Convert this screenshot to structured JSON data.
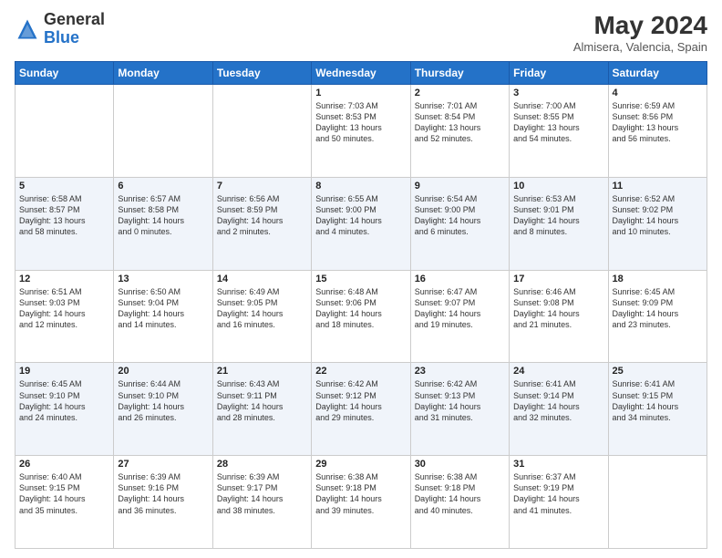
{
  "header": {
    "logo_general": "General",
    "logo_blue": "Blue",
    "month_title": "May 2024",
    "location": "Almisera, Valencia, Spain"
  },
  "weekdays": [
    "Sunday",
    "Monday",
    "Tuesday",
    "Wednesday",
    "Thursday",
    "Friday",
    "Saturday"
  ],
  "weeks": [
    [
      {
        "day": "",
        "info": ""
      },
      {
        "day": "",
        "info": ""
      },
      {
        "day": "",
        "info": ""
      },
      {
        "day": "1",
        "info": "Sunrise: 7:03 AM\nSunset: 8:53 PM\nDaylight: 13 hours\nand 50 minutes."
      },
      {
        "day": "2",
        "info": "Sunrise: 7:01 AM\nSunset: 8:54 PM\nDaylight: 13 hours\nand 52 minutes."
      },
      {
        "day": "3",
        "info": "Sunrise: 7:00 AM\nSunset: 8:55 PM\nDaylight: 13 hours\nand 54 minutes."
      },
      {
        "day": "4",
        "info": "Sunrise: 6:59 AM\nSunset: 8:56 PM\nDaylight: 13 hours\nand 56 minutes."
      }
    ],
    [
      {
        "day": "5",
        "info": "Sunrise: 6:58 AM\nSunset: 8:57 PM\nDaylight: 13 hours\nand 58 minutes."
      },
      {
        "day": "6",
        "info": "Sunrise: 6:57 AM\nSunset: 8:58 PM\nDaylight: 14 hours\nand 0 minutes."
      },
      {
        "day": "7",
        "info": "Sunrise: 6:56 AM\nSunset: 8:59 PM\nDaylight: 14 hours\nand 2 minutes."
      },
      {
        "day": "8",
        "info": "Sunrise: 6:55 AM\nSunset: 9:00 PM\nDaylight: 14 hours\nand 4 minutes."
      },
      {
        "day": "9",
        "info": "Sunrise: 6:54 AM\nSunset: 9:00 PM\nDaylight: 14 hours\nand 6 minutes."
      },
      {
        "day": "10",
        "info": "Sunrise: 6:53 AM\nSunset: 9:01 PM\nDaylight: 14 hours\nand 8 minutes."
      },
      {
        "day": "11",
        "info": "Sunrise: 6:52 AM\nSunset: 9:02 PM\nDaylight: 14 hours\nand 10 minutes."
      }
    ],
    [
      {
        "day": "12",
        "info": "Sunrise: 6:51 AM\nSunset: 9:03 PM\nDaylight: 14 hours\nand 12 minutes."
      },
      {
        "day": "13",
        "info": "Sunrise: 6:50 AM\nSunset: 9:04 PM\nDaylight: 14 hours\nand 14 minutes."
      },
      {
        "day": "14",
        "info": "Sunrise: 6:49 AM\nSunset: 9:05 PM\nDaylight: 14 hours\nand 16 minutes."
      },
      {
        "day": "15",
        "info": "Sunrise: 6:48 AM\nSunset: 9:06 PM\nDaylight: 14 hours\nand 18 minutes."
      },
      {
        "day": "16",
        "info": "Sunrise: 6:47 AM\nSunset: 9:07 PM\nDaylight: 14 hours\nand 19 minutes."
      },
      {
        "day": "17",
        "info": "Sunrise: 6:46 AM\nSunset: 9:08 PM\nDaylight: 14 hours\nand 21 minutes."
      },
      {
        "day": "18",
        "info": "Sunrise: 6:45 AM\nSunset: 9:09 PM\nDaylight: 14 hours\nand 23 minutes."
      }
    ],
    [
      {
        "day": "19",
        "info": "Sunrise: 6:45 AM\nSunset: 9:10 PM\nDaylight: 14 hours\nand 24 minutes."
      },
      {
        "day": "20",
        "info": "Sunrise: 6:44 AM\nSunset: 9:10 PM\nDaylight: 14 hours\nand 26 minutes."
      },
      {
        "day": "21",
        "info": "Sunrise: 6:43 AM\nSunset: 9:11 PM\nDaylight: 14 hours\nand 28 minutes."
      },
      {
        "day": "22",
        "info": "Sunrise: 6:42 AM\nSunset: 9:12 PM\nDaylight: 14 hours\nand 29 minutes."
      },
      {
        "day": "23",
        "info": "Sunrise: 6:42 AM\nSunset: 9:13 PM\nDaylight: 14 hours\nand 31 minutes."
      },
      {
        "day": "24",
        "info": "Sunrise: 6:41 AM\nSunset: 9:14 PM\nDaylight: 14 hours\nand 32 minutes."
      },
      {
        "day": "25",
        "info": "Sunrise: 6:41 AM\nSunset: 9:15 PM\nDaylight: 14 hours\nand 34 minutes."
      }
    ],
    [
      {
        "day": "26",
        "info": "Sunrise: 6:40 AM\nSunset: 9:15 PM\nDaylight: 14 hours\nand 35 minutes."
      },
      {
        "day": "27",
        "info": "Sunrise: 6:39 AM\nSunset: 9:16 PM\nDaylight: 14 hours\nand 36 minutes."
      },
      {
        "day": "28",
        "info": "Sunrise: 6:39 AM\nSunset: 9:17 PM\nDaylight: 14 hours\nand 38 minutes."
      },
      {
        "day": "29",
        "info": "Sunrise: 6:38 AM\nSunset: 9:18 PM\nDaylight: 14 hours\nand 39 minutes."
      },
      {
        "day": "30",
        "info": "Sunrise: 6:38 AM\nSunset: 9:18 PM\nDaylight: 14 hours\nand 40 minutes."
      },
      {
        "day": "31",
        "info": "Sunrise: 6:37 AM\nSunset: 9:19 PM\nDaylight: 14 hours\nand 41 minutes."
      },
      {
        "day": "",
        "info": ""
      }
    ]
  ]
}
